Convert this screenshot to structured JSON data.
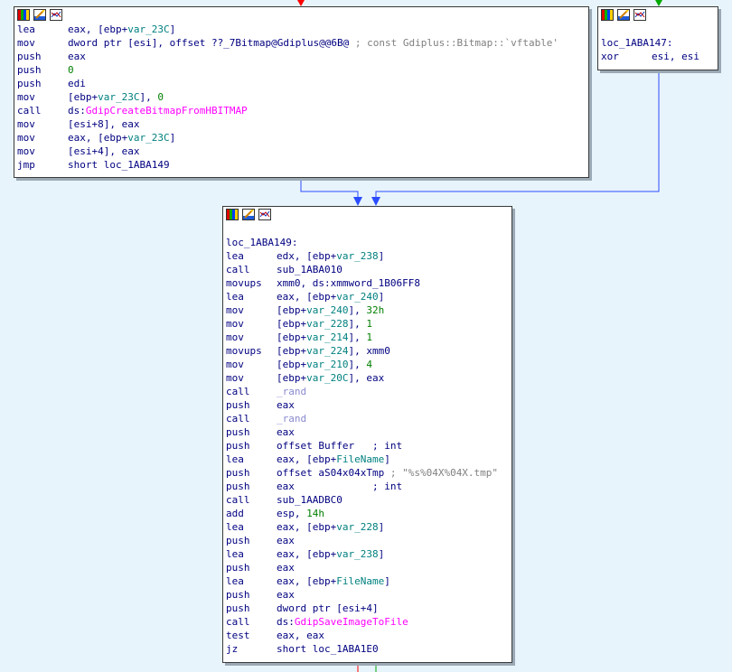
{
  "colors": {
    "background": "#e8f4fb",
    "edge_true": "#00aa00",
    "edge_false": "#ff0000",
    "edge_jump": "#2b4cff"
  },
  "header_icons": [
    "color-palette-icon",
    "edit-pencil-icon",
    "graph-overview-icon"
  ],
  "block_top_left": {
    "lines": [
      {
        "mn": "lea",
        "ops": [
          {
            "t": "eax, [ebp+",
            "c": "ops"
          },
          {
            "t": "var_23C",
            "c": "var"
          },
          {
            "t": "]",
            "c": "ops"
          }
        ]
      },
      {
        "mn": "mov",
        "ops": [
          {
            "t": "dword ptr [esi], offset ??_7Bitmap@Gdiplus@@6B@",
            "c": "ops"
          },
          {
            "t": " ; const Gdiplus::Bitmap::`vftable'",
            "c": "cmt"
          }
        ]
      },
      {
        "mn": "push",
        "ops": [
          {
            "t": "eax",
            "c": "ops"
          }
        ]
      },
      {
        "mn": "push",
        "ops": [
          {
            "t": "0",
            "c": "num"
          }
        ]
      },
      {
        "mn": "push",
        "ops": [
          {
            "t": "edi",
            "c": "ops"
          }
        ]
      },
      {
        "mn": "mov",
        "ops": [
          {
            "t": "[ebp+",
            "c": "ops"
          },
          {
            "t": "var_23C",
            "c": "var"
          },
          {
            "t": "], ",
            "c": "ops"
          },
          {
            "t": "0",
            "c": "num"
          }
        ]
      },
      {
        "mn": "call",
        "ops": [
          {
            "t": "ds:",
            "c": "ops"
          },
          {
            "t": "GdipCreateBitmapFromHBITMAP",
            "c": "imp"
          }
        ]
      },
      {
        "mn": "mov",
        "ops": [
          {
            "t": "[esi+8], eax",
            "c": "ops"
          }
        ]
      },
      {
        "mn": "mov",
        "ops": [
          {
            "t": "eax, [ebp+",
            "c": "ops"
          },
          {
            "t": "var_23C",
            "c": "var"
          },
          {
            "t": "]",
            "c": "ops"
          }
        ]
      },
      {
        "mn": "mov",
        "ops": [
          {
            "t": "[esi+4], eax",
            "c": "ops"
          }
        ]
      },
      {
        "mn": "jmp",
        "ops": [
          {
            "t": "short loc_1ABA149",
            "c": "ops"
          }
        ]
      }
    ]
  },
  "block_top_right": {
    "label": "loc_1ABA147:",
    "lines": [
      {
        "mn": "xor",
        "ops": [
          {
            "t": "esi, esi",
            "c": "ops"
          }
        ]
      }
    ]
  },
  "block_main": {
    "label": "loc_1ABA149:",
    "lines": [
      {
        "mn": "lea",
        "ops": [
          {
            "t": "edx, [ebp+",
            "c": "ops"
          },
          {
            "t": "var_238",
            "c": "var"
          },
          {
            "t": "]",
            "c": "ops"
          }
        ]
      },
      {
        "mn": "call",
        "ops": [
          {
            "t": "sub_1ABA010",
            "c": "ops"
          }
        ]
      },
      {
        "mn": "movups",
        "ops": [
          {
            "t": "xmm0, ds:xmmword_1B06FF8",
            "c": "ops"
          }
        ]
      },
      {
        "mn": "lea",
        "ops": [
          {
            "t": "eax, [ebp+",
            "c": "ops"
          },
          {
            "t": "var_240",
            "c": "var"
          },
          {
            "t": "]",
            "c": "ops"
          }
        ]
      },
      {
        "mn": "mov",
        "ops": [
          {
            "t": "[ebp+",
            "c": "ops"
          },
          {
            "t": "var_240",
            "c": "var"
          },
          {
            "t": "], ",
            "c": "ops"
          },
          {
            "t": "32h",
            "c": "num"
          }
        ]
      },
      {
        "mn": "mov",
        "ops": [
          {
            "t": "[ebp+",
            "c": "ops"
          },
          {
            "t": "var_228",
            "c": "var"
          },
          {
            "t": "], ",
            "c": "ops"
          },
          {
            "t": "1",
            "c": "num"
          }
        ]
      },
      {
        "mn": "mov",
        "ops": [
          {
            "t": "[ebp+",
            "c": "ops"
          },
          {
            "t": "var_214",
            "c": "var"
          },
          {
            "t": "], ",
            "c": "ops"
          },
          {
            "t": "1",
            "c": "num"
          }
        ]
      },
      {
        "mn": "movups",
        "ops": [
          {
            "t": "[ebp+",
            "c": "ops"
          },
          {
            "t": "var_224",
            "c": "var"
          },
          {
            "t": "], xmm0",
            "c": "ops"
          }
        ]
      },
      {
        "mn": "mov",
        "ops": [
          {
            "t": "[ebp+",
            "c": "ops"
          },
          {
            "t": "var_210",
            "c": "var"
          },
          {
            "t": "], ",
            "c": "ops"
          },
          {
            "t": "4",
            "c": "num"
          }
        ]
      },
      {
        "mn": "mov",
        "ops": [
          {
            "t": "[ebp+",
            "c": "ops"
          },
          {
            "t": "var_20C",
            "c": "var"
          },
          {
            "t": "], eax",
            "c": "ops"
          }
        ]
      },
      {
        "mn": "call",
        "ops": [
          {
            "t": "_rand",
            "c": "lib"
          }
        ]
      },
      {
        "mn": "push",
        "ops": [
          {
            "t": "eax",
            "c": "ops"
          }
        ]
      },
      {
        "mn": "call",
        "ops": [
          {
            "t": "_rand",
            "c": "lib"
          }
        ]
      },
      {
        "mn": "push",
        "ops": [
          {
            "t": "eax",
            "c": "ops"
          }
        ]
      },
      {
        "mn": "push",
        "ops": [
          {
            "t": "offset Buffer   ",
            "c": "ops"
          },
          {
            "t": "; int",
            "c": "ops"
          }
        ]
      },
      {
        "mn": "lea",
        "ops": [
          {
            "t": "eax, [ebp+",
            "c": "ops"
          },
          {
            "t": "FileName",
            "c": "var"
          },
          {
            "t": "]",
            "c": "ops"
          }
        ]
      },
      {
        "mn": "push",
        "ops": [
          {
            "t": "offset aS04x04xTmp",
            "c": "ops"
          },
          {
            "t": " ; \"%s%04X%04X.tmp\"",
            "c": "str"
          }
        ]
      },
      {
        "mn": "push",
        "ops": [
          {
            "t": "eax             ",
            "c": "ops"
          },
          {
            "t": "; int",
            "c": "ops"
          }
        ]
      },
      {
        "mn": "call",
        "ops": [
          {
            "t": "sub_1AADBC0",
            "c": "ops"
          }
        ]
      },
      {
        "mn": "add",
        "ops": [
          {
            "t": "esp, ",
            "c": "ops"
          },
          {
            "t": "14h",
            "c": "num"
          }
        ]
      },
      {
        "mn": "lea",
        "ops": [
          {
            "t": "eax, [ebp+",
            "c": "ops"
          },
          {
            "t": "var_228",
            "c": "var"
          },
          {
            "t": "]",
            "c": "ops"
          }
        ]
      },
      {
        "mn": "push",
        "ops": [
          {
            "t": "eax",
            "c": "ops"
          }
        ]
      },
      {
        "mn": "lea",
        "ops": [
          {
            "t": "eax, [ebp+",
            "c": "ops"
          },
          {
            "t": "var_238",
            "c": "var"
          },
          {
            "t": "]",
            "c": "ops"
          }
        ]
      },
      {
        "mn": "push",
        "ops": [
          {
            "t": "eax",
            "c": "ops"
          }
        ]
      },
      {
        "mn": "lea",
        "ops": [
          {
            "t": "eax, [ebp+",
            "c": "ops"
          },
          {
            "t": "FileName",
            "c": "var"
          },
          {
            "t": "]",
            "c": "ops"
          }
        ]
      },
      {
        "mn": "push",
        "ops": [
          {
            "t": "eax",
            "c": "ops"
          }
        ]
      },
      {
        "mn": "push",
        "ops": [
          {
            "t": "dword ptr [esi+4]",
            "c": "ops"
          }
        ]
      },
      {
        "mn": "call",
        "ops": [
          {
            "t": "ds:",
            "c": "ops"
          },
          {
            "t": "GdipSaveImageToFile",
            "c": "imp"
          }
        ]
      },
      {
        "mn": "test",
        "ops": [
          {
            "t": "eax, eax",
            "c": "ops"
          }
        ]
      },
      {
        "mn": "jz",
        "ops": [
          {
            "t": "short loc_1ABA1E0",
            "c": "ops"
          }
        ]
      }
    ]
  }
}
